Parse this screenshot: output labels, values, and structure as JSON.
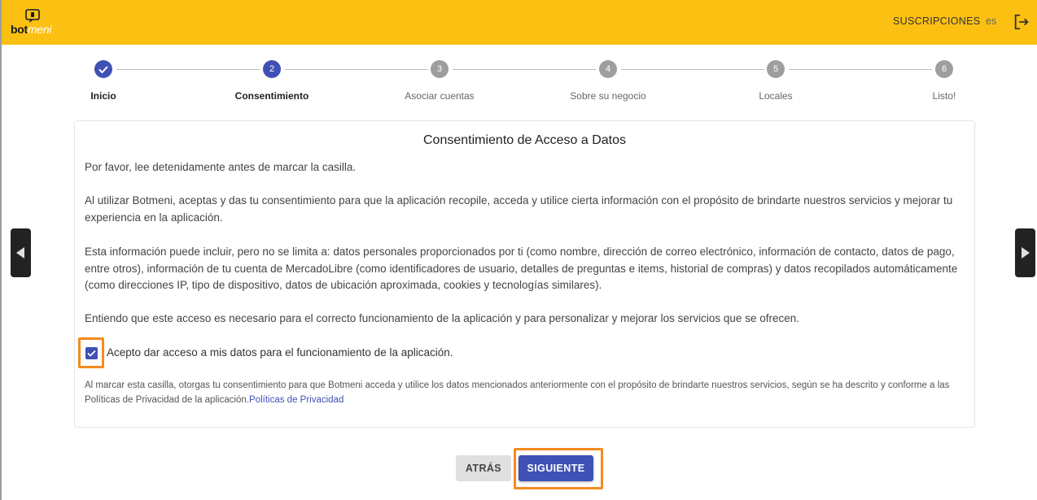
{
  "header": {
    "logo_text_1": "bot",
    "logo_text_2": "meni",
    "subscriptions_label": "SUSCRIPCIONES",
    "language": "es",
    "logout_icon": "logout-icon"
  },
  "stepper": {
    "steps": [
      {
        "label": "Inicio",
        "number": "",
        "state": "completed"
      },
      {
        "label": "Consentimiento",
        "number": "2",
        "state": "active"
      },
      {
        "label": "Asociar cuentas",
        "number": "3",
        "state": "pending"
      },
      {
        "label": "Sobre su negocio",
        "number": "4",
        "state": "pending"
      },
      {
        "label": "Locales",
        "number": "5",
        "state": "pending"
      },
      {
        "label": "Listo!",
        "number": "6",
        "state": "pending"
      }
    ]
  },
  "card": {
    "title": "Consentimiento de Acceso a Datos",
    "p1": "Por favor, lee detenidamente antes de marcar la casilla.",
    "p2": "Al utilizar Botmeni, aceptas y das tu consentimiento para que la aplicación recopile, acceda y utilice cierta información con el propósito de brindarte nuestros servicios y mejorar tu experiencia en la aplicación.",
    "p3": "Esta información puede incluir, pero no se limita a: datos personales proporcionados por ti (como nombre, dirección de correo electrónico, información de contacto, datos de pago, entre otros), información de tu cuenta de MercadoLibre (como identificadores de usuario, detalles de preguntas e items, historial de compras) y datos recopilados automáticamente (como direcciones IP, tipo de dispositivo, datos de ubicación aproximada, cookies y tecnologías similares).",
    "p4": "Entiendo que este acceso es necesario para el correcto funcionamiento de la aplicación y para personalizar y mejorar los servicios que se ofrecen.",
    "checkbox_label": "Acepto dar acceso a mis datos para el funcionamiento de la aplicación.",
    "checkbox_checked": true,
    "fine_print": "Al marcar esta casilla, otorgas tu consentimiento para que Botmeni acceda y utilice los datos mencionados anteriormente con el propósito de brindarte nuestros servicios, según se ha descrito y conforme a las Políticas de Privacidad de la aplicación.",
    "privacy_link": "Políticas de Privacidad"
  },
  "buttons": {
    "back": "ATRÁS",
    "next": "SIGUIENTE"
  },
  "colors": {
    "header": "#fbc012",
    "primary": "#3f51b5",
    "highlight": "#f58a1f"
  }
}
